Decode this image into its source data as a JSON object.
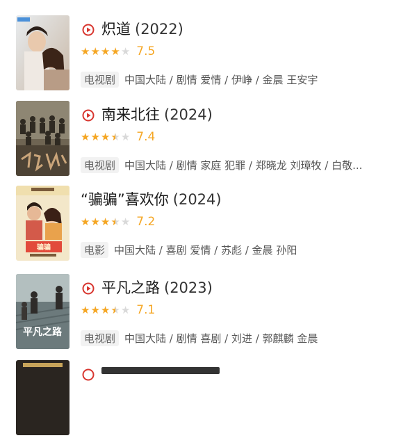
{
  "items": [
    {
      "title": "炽道",
      "year": "(2022)",
      "score": "7.5",
      "stars": [
        "full",
        "full",
        "full",
        "full",
        "empty"
      ],
      "type": "电视剧",
      "info": "中国大陆 / 剧情 爱情 / 伊峥 / 金晨 王安宇",
      "has_play_icon": true
    },
    {
      "title": "南来北往",
      "year": "(2024)",
      "score": "7.4",
      "stars": [
        "full",
        "full",
        "full",
        "half",
        "empty"
      ],
      "type": "电视剧",
      "info": "中国大陆 / 剧情 家庭 犯罪 / 郑晓龙 刘璋牧 / 白敬...",
      "has_play_icon": true
    },
    {
      "title": "“骗骗”喜欢你",
      "year": "(2024)",
      "score": "7.2",
      "stars": [
        "full",
        "full",
        "full",
        "half",
        "empty"
      ],
      "type": "电影",
      "info": "中国大陆 / 喜剧 爱情 / 苏彪 / 金晨 孙阳",
      "has_play_icon": false
    },
    {
      "title": "平凡之路",
      "year": "(2023)",
      "score": "7.1",
      "stars": [
        "full",
        "full",
        "full",
        "half",
        "empty"
      ],
      "type": "电视剧",
      "info": "中国大陆 / 剧情 喜剧 / 刘进 / 郭麒麟 金晨",
      "has_play_icon": true
    }
  ],
  "poster_art": {
    "poster3_title": "骗骗",
    "poster4_title": "平凡之路"
  },
  "colors": {
    "accent_red": "#d8362f",
    "star_gold": "#f5a623"
  }
}
